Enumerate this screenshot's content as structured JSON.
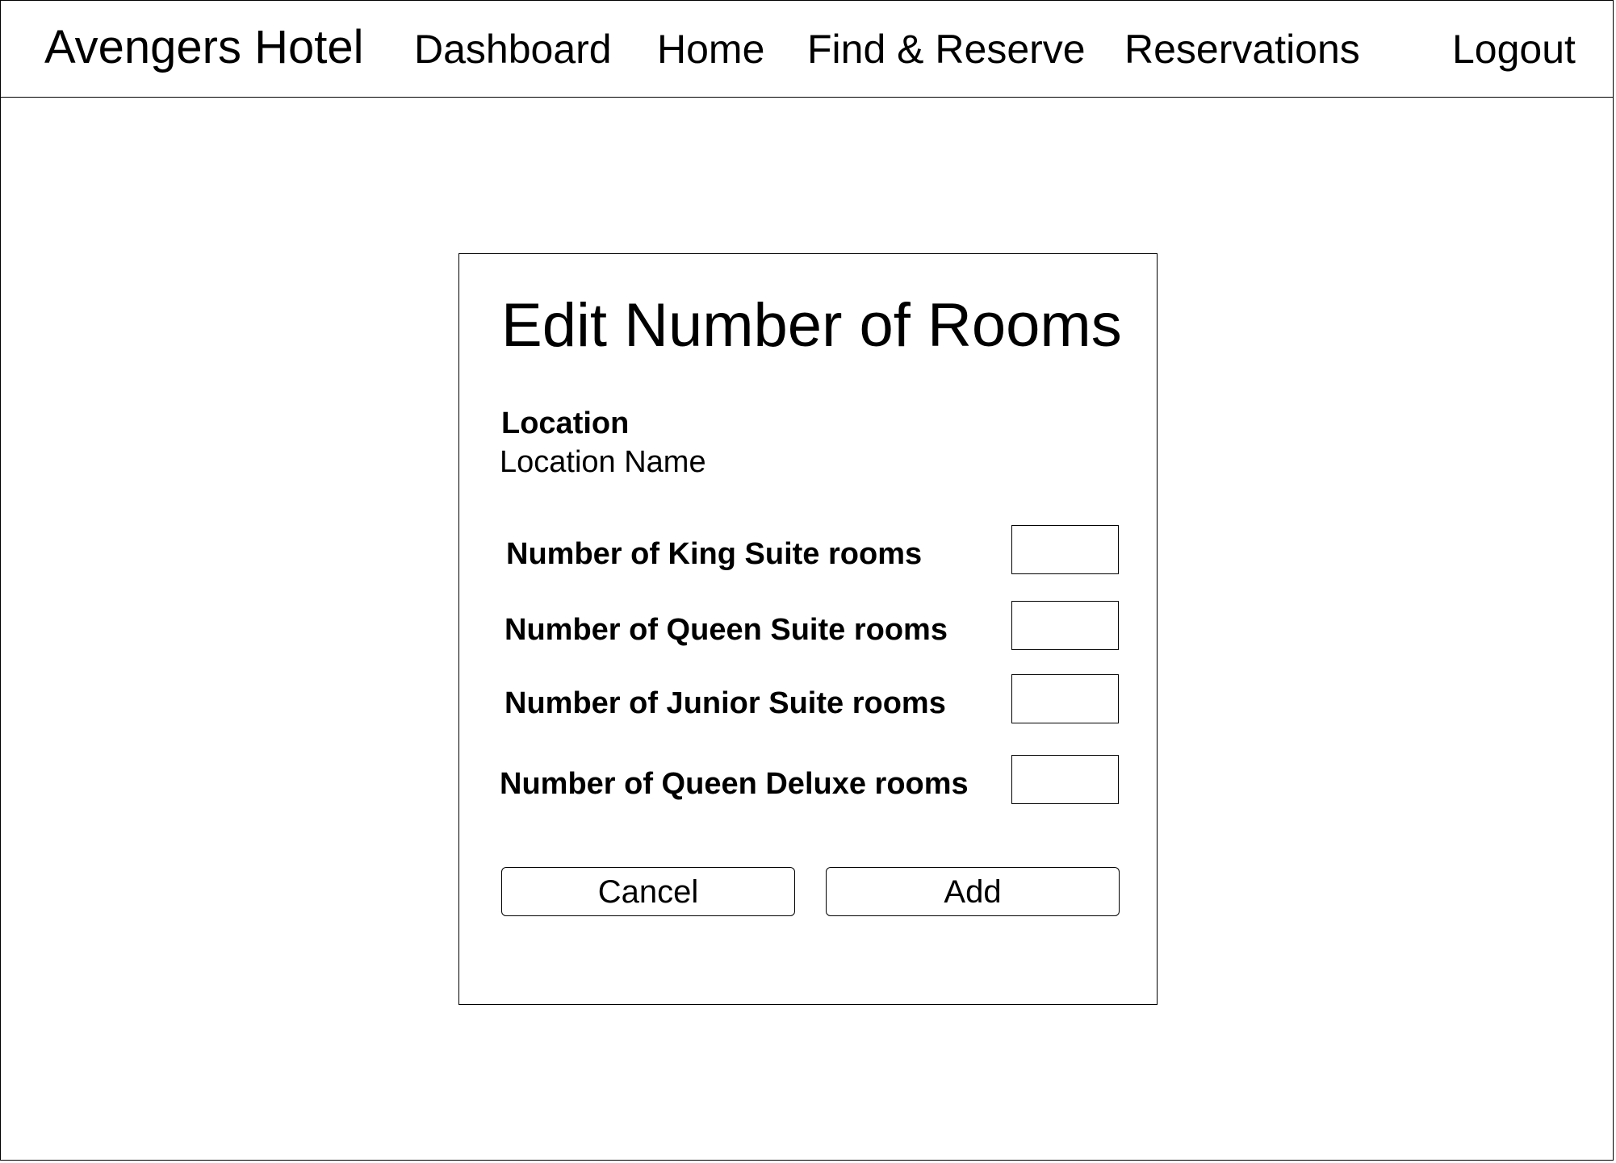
{
  "header": {
    "brand": "Avengers Hotel",
    "nav": {
      "dashboard": "Dashboard",
      "home": "Home",
      "find_reserve": "Find & Reserve",
      "reservations": "Reservations",
      "logout": "Logout"
    }
  },
  "dialog": {
    "title": "Edit Number of Rooms",
    "location_label": "Location",
    "location_value": "Location Name",
    "fields": [
      {
        "label": "Number of King Suite rooms",
        "value": ""
      },
      {
        "label": "Number of Queen Suite rooms",
        "value": ""
      },
      {
        "label": "Number of Junior Suite rooms",
        "value": ""
      },
      {
        "label": "Number of Queen Deluxe rooms",
        "value": ""
      }
    ],
    "buttons": {
      "cancel": "Cancel",
      "add": "Add"
    }
  }
}
